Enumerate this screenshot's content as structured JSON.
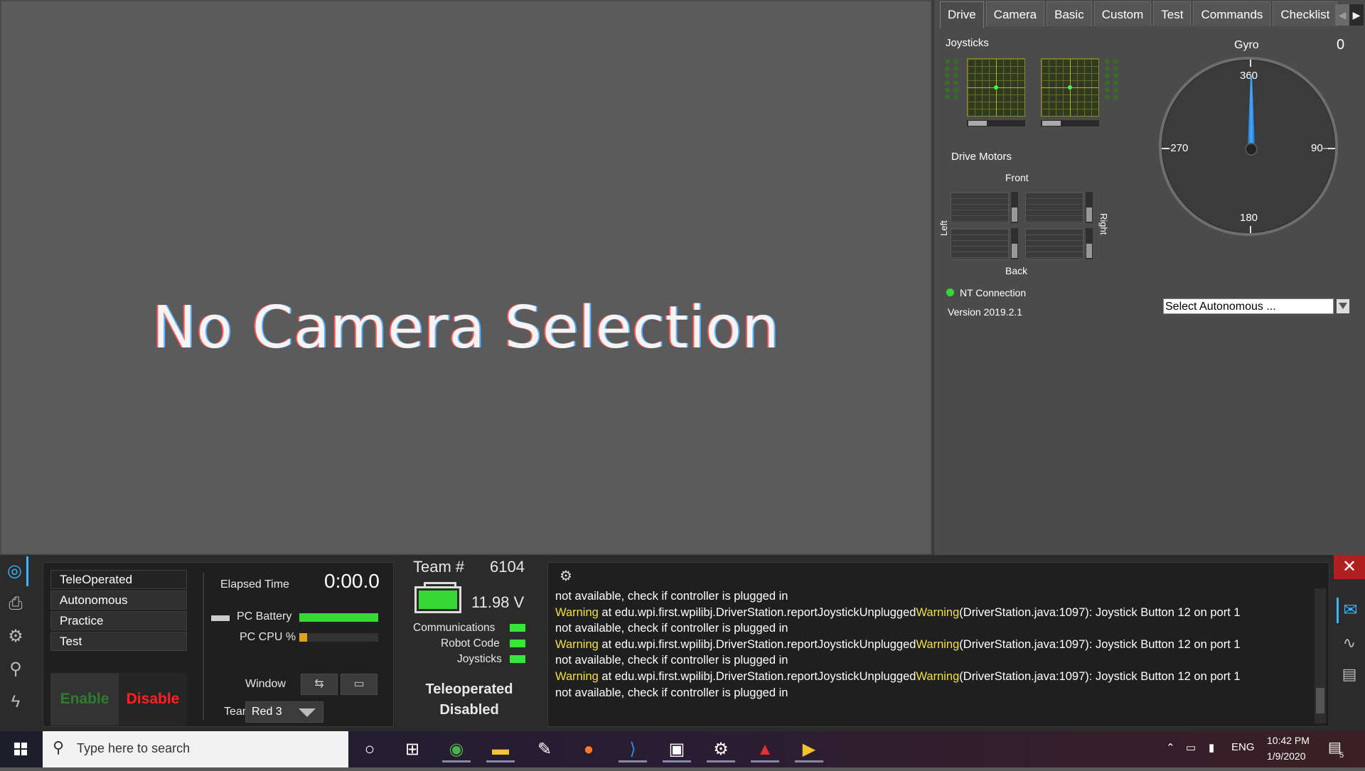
{
  "camera": {
    "message": "No Camera Selection"
  },
  "dashboard": {
    "tabs": [
      "Drive",
      "Camera",
      "Basic",
      "Custom",
      "Test",
      "Commands",
      "Checklist"
    ],
    "active_tab": "Drive",
    "joysticks_label": "Joysticks",
    "drive_motors_label": "Drive Motors",
    "front_label": "Front",
    "back_label": "Back",
    "left_label": "Left",
    "right_label": "Right",
    "nt_connection_label": "NT Connection",
    "version": "Version 2019.2.1",
    "gyro": {
      "title": "Gyro",
      "value": "0",
      "labels": {
        "top": "360",
        "right": "90–",
        "bottom": "180",
        "left": "–270"
      }
    },
    "auto_select_placeholder": "Select Autonomous ..."
  },
  "driver_station": {
    "modes": [
      "TeleOperated",
      "Autonomous",
      "Practice",
      "Test"
    ],
    "active_mode": "TeleOperated",
    "enable_label": "Enable",
    "disable_label": "Disable",
    "elapsed_label": "Elapsed Time",
    "elapsed_value": "0:00.0",
    "pc_battery_label": "PC Battery",
    "pc_battery_level": 1.0,
    "pc_cpu_label": "PC CPU %",
    "pc_cpu_level": 0.1,
    "window_label": "Window",
    "team_station_label": "Team Station",
    "team_station_value": "Red 3",
    "team_label": "Team #",
    "team_number": "6104",
    "voltage": "11.98 V",
    "indicators": [
      "Communications",
      "Robot Code",
      "Joysticks"
    ],
    "status_line1": "Teleoperated",
    "status_line2": "Disabled",
    "messages": [
      {
        "warn": "",
        "text": "not available, check if controller is plugged in"
      },
      {
        "warn": "Warning",
        "text": " at edu.wpi.first.wpilibj.DriverStation.reportJoystickUnplugged",
        "warn2": "Warning",
        "text2": "(DriverStation.java:1097): Joystick Button 12 on port 1"
      },
      {
        "warn": "",
        "text": "not available, check if controller is plugged in"
      },
      {
        "warn": "Warning",
        "text": " at edu.wpi.first.wpilibj.DriverStation.reportJoystickUnplugged",
        "warn2": "Warning",
        "text2": "(DriverStation.java:1097): Joystick Button 12 on port 1"
      },
      {
        "warn": "",
        "text": "not available, check if controller is plugged in"
      },
      {
        "warn": "Warning",
        "text": " at edu.wpi.first.wpilibj.DriverStation.reportJoystickUnplugged",
        "warn2": "Warning",
        "text2": "(DriverStation.java:1097): Joystick Button 12 on port 1"
      },
      {
        "warn": "",
        "text": "not available, check if controller is plugged in"
      }
    ]
  },
  "taskbar": {
    "search_placeholder": "Type here to search",
    "time": "10:42 PM",
    "date": "1/9/2020",
    "language": "ENG",
    "notification_count": "5"
  },
  "colors": {
    "accent": "#37b6ff",
    "ok_green": "#35e835",
    "warn_yellow": "#f0e040",
    "disable_red": "#ff2020"
  }
}
